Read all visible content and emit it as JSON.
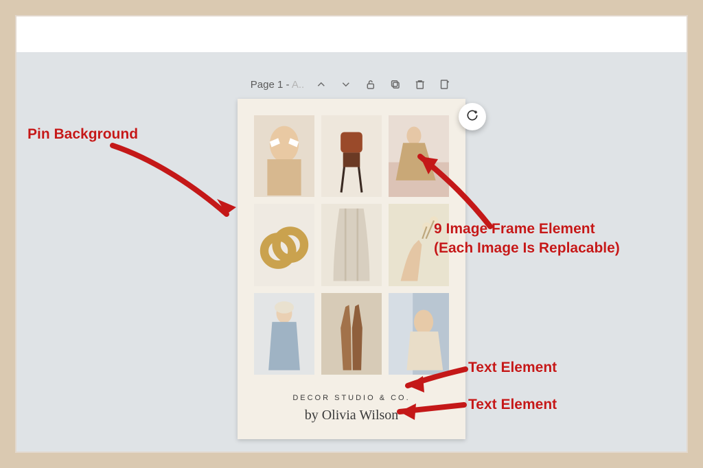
{
  "toolbar": {
    "page_label": "Page 1 -",
    "page_label_muted": "A..",
    "icons": [
      "up",
      "down",
      "lock",
      "duplicate",
      "trash",
      "add-page"
    ]
  },
  "pin": {
    "title": "DECOR STUDIO & CO.",
    "byline": "by Olivia Wilson",
    "frames": [
      {
        "name": "woman-sunglasses"
      },
      {
        "name": "chair"
      },
      {
        "name": "woman-seated-sofa"
      },
      {
        "name": "gold-rings"
      },
      {
        "name": "draped-fabric"
      },
      {
        "name": "hand-flower"
      },
      {
        "name": "woman-denim"
      },
      {
        "name": "hands-raised"
      },
      {
        "name": "profile-scarf"
      }
    ]
  },
  "annotations": {
    "pin_background": "Pin Background",
    "image_frames_line1": "9 Image Frame Element",
    "image_frames_line2": "(Each Image Is Replacable)",
    "text_element": "Text Element"
  },
  "fab": {
    "name": "comment"
  }
}
